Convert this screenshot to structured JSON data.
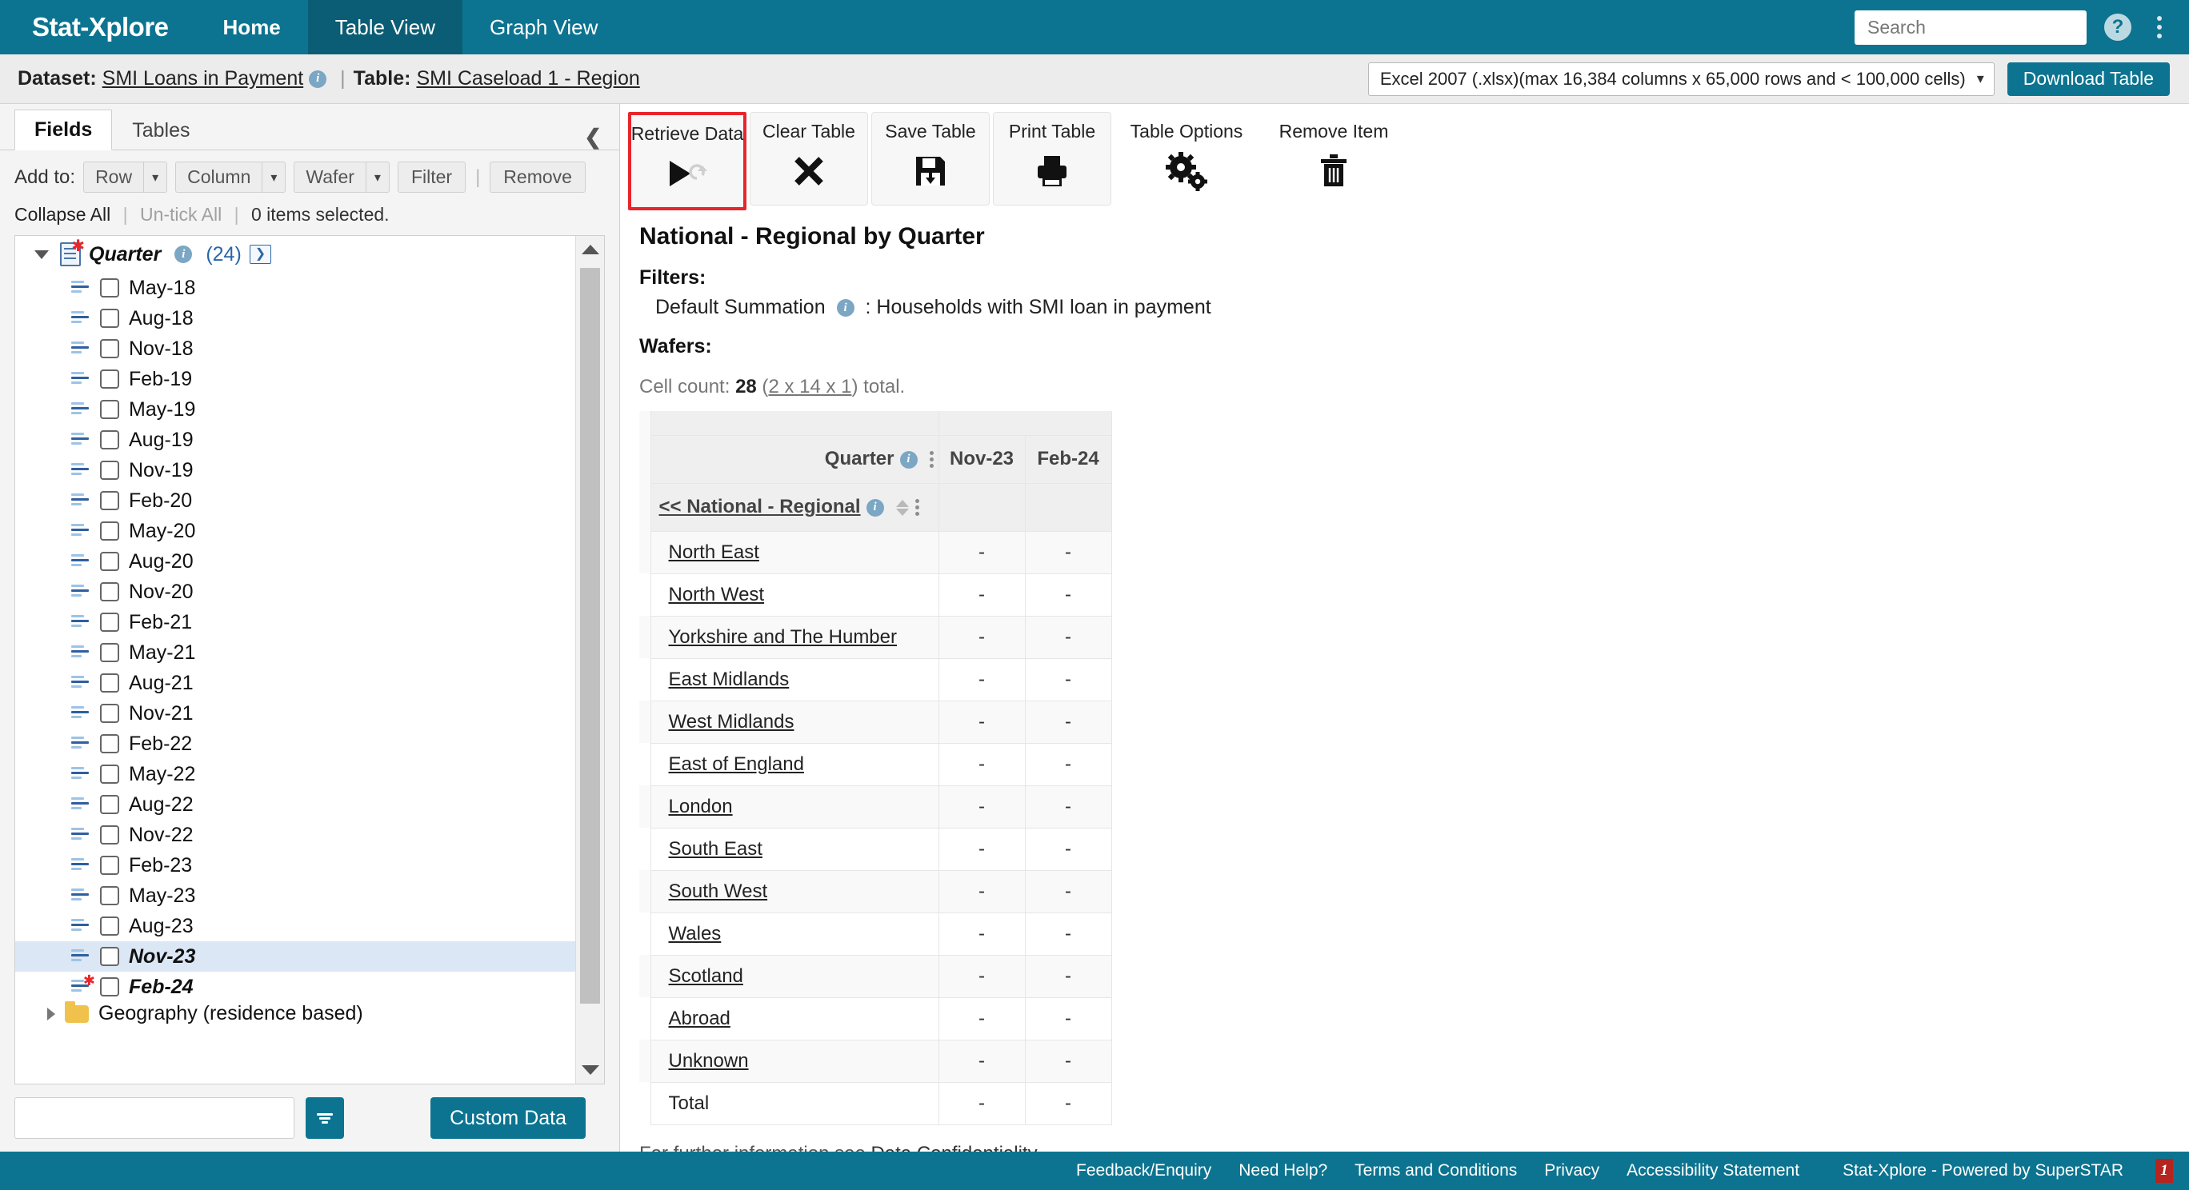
{
  "header": {
    "brand": "Stat-Xplore",
    "tabs": [
      {
        "label": "Home",
        "active": false,
        "bold": true
      },
      {
        "label": "Table View",
        "active": true,
        "bold": false
      },
      {
        "label": "Graph View",
        "active": false,
        "bold": false
      }
    ],
    "search_placeholder": "Search",
    "search_value": "",
    "help_glyph": "?",
    "accent_color": "#0c7490",
    "active_tab_color": "#0a5d74"
  },
  "dataset_bar": {
    "dataset_label": "Dataset:",
    "dataset_name": "SMI Loans in Payment",
    "table_label": "Table:",
    "table_name": "SMI Caseload 1 - Region",
    "format_value": "Excel 2007 (.xlsx)(max 16,384 columns x 65,000 rows and < 100,000 cells)",
    "download_label": "Download Table"
  },
  "left_pane": {
    "tabs": [
      {
        "label": "Fields",
        "active": true
      },
      {
        "label": "Tables",
        "active": false
      }
    ],
    "add_to_label": "Add to:",
    "add_to_buttons": [
      "Row",
      "Column",
      "Wafer"
    ],
    "filter_button": "Filter",
    "remove_button": "Remove",
    "collapse_all": "Collapse All",
    "untick_all": "Un-tick All",
    "selected_text": "0 items selected.",
    "tree": {
      "root": {
        "name": "Quarter",
        "count": "(24)",
        "next": "›"
      },
      "items": [
        {
          "label": "May-18",
          "selected": false,
          "bold": false,
          "new": false
        },
        {
          "label": "Aug-18",
          "selected": false,
          "bold": false,
          "new": false
        },
        {
          "label": "Nov-18",
          "selected": false,
          "bold": false,
          "new": false
        },
        {
          "label": "Feb-19",
          "selected": false,
          "bold": false,
          "new": false
        },
        {
          "label": "May-19",
          "selected": false,
          "bold": false,
          "new": false
        },
        {
          "label": "Aug-19",
          "selected": false,
          "bold": false,
          "new": false
        },
        {
          "label": "Nov-19",
          "selected": false,
          "bold": false,
          "new": false
        },
        {
          "label": "Feb-20",
          "selected": false,
          "bold": false,
          "new": false
        },
        {
          "label": "May-20",
          "selected": false,
          "bold": false,
          "new": false
        },
        {
          "label": "Aug-20",
          "selected": false,
          "bold": false,
          "new": false
        },
        {
          "label": "Nov-20",
          "selected": false,
          "bold": false,
          "new": false
        },
        {
          "label": "Feb-21",
          "selected": false,
          "bold": false,
          "new": false
        },
        {
          "label": "May-21",
          "selected": false,
          "bold": false,
          "new": false
        },
        {
          "label": "Aug-21",
          "selected": false,
          "bold": false,
          "new": false
        },
        {
          "label": "Nov-21",
          "selected": false,
          "bold": false,
          "new": false
        },
        {
          "label": "Feb-22",
          "selected": false,
          "bold": false,
          "new": false
        },
        {
          "label": "May-22",
          "selected": false,
          "bold": false,
          "new": false
        },
        {
          "label": "Aug-22",
          "selected": false,
          "bold": false,
          "new": false
        },
        {
          "label": "Nov-22",
          "selected": false,
          "bold": false,
          "new": false
        },
        {
          "label": "Feb-23",
          "selected": false,
          "bold": false,
          "new": false
        },
        {
          "label": "May-23",
          "selected": false,
          "bold": false,
          "new": false
        },
        {
          "label": "Aug-23",
          "selected": false,
          "bold": false,
          "new": false
        },
        {
          "label": "Nov-23",
          "selected": true,
          "bold": true,
          "new": false
        },
        {
          "label": "Feb-24",
          "selected": false,
          "bold": true,
          "new": true
        }
      ],
      "next_folder": "Geography (residence based)"
    },
    "field_input_value": "",
    "custom_data_label": "Custom Data"
  },
  "toolbar": {
    "buttons": [
      {
        "label": "Retrieve Data",
        "icon": "play-icon",
        "highlighted": true,
        "flat": false
      },
      {
        "label": "Clear Table",
        "icon": "cross-icon",
        "highlighted": false,
        "flat": false
      },
      {
        "label": "Save Table",
        "icon": "floppy-disk-icon",
        "highlighted": false,
        "flat": false
      },
      {
        "label": "Print Table",
        "icon": "printer-icon",
        "highlighted": false,
        "flat": false
      },
      {
        "label": "Table Options",
        "icon": "gears-icon",
        "highlighted": false,
        "flat": true
      },
      {
        "label": "Remove Item",
        "icon": "trash-icon",
        "highlighted": false,
        "flat": true
      }
    ],
    "highlight_color": "#e8252b"
  },
  "table_view": {
    "title": "National - Regional by Quarter",
    "filters_label": "Filters:",
    "filter_line_name": "Default Summation",
    "filter_line_value": ": Households with SMI loan in payment",
    "wafers_label": "Wafers:",
    "cell_count_prefix": "Cell count:",
    "cell_count": "28",
    "cell_count_dims": "2 x 14 x 1",
    "cell_count_suffix": "total.",
    "column_dimension": "Quarter",
    "row_dimension": "<< National - Regional",
    "columns": [
      "Nov-23",
      "Feb-24"
    ],
    "rows": [
      {
        "label": "North East",
        "link": true,
        "values": [
          "-",
          "-"
        ]
      },
      {
        "label": "North West",
        "link": true,
        "values": [
          "-",
          "-"
        ]
      },
      {
        "label": "Yorkshire and The Humber",
        "link": true,
        "values": [
          "-",
          "-"
        ]
      },
      {
        "label": "East Midlands",
        "link": true,
        "values": [
          "-",
          "-"
        ]
      },
      {
        "label": "West Midlands",
        "link": true,
        "values": [
          "-",
          "-"
        ]
      },
      {
        "label": "East of England",
        "link": true,
        "values": [
          "-",
          "-"
        ]
      },
      {
        "label": "London",
        "link": true,
        "values": [
          "-",
          "-"
        ]
      },
      {
        "label": "South East",
        "link": true,
        "values": [
          "-",
          "-"
        ]
      },
      {
        "label": "South West",
        "link": true,
        "values": [
          "-",
          "-"
        ]
      },
      {
        "label": "Wales",
        "link": true,
        "values": [
          "-",
          "-"
        ]
      },
      {
        "label": "Scotland",
        "link": true,
        "values": [
          "-",
          "-"
        ]
      },
      {
        "label": "Abroad",
        "link": true,
        "values": [
          "-",
          "-"
        ]
      },
      {
        "label": "Unknown",
        "link": true,
        "values": [
          "-",
          "-"
        ]
      },
      {
        "label": "Total",
        "link": false,
        "values": [
          "-",
          "-"
        ]
      }
    ],
    "further_info_prefix": "For further information see",
    "further_info_link": "Data Confidentiality"
  },
  "footer": {
    "links": [
      "Feedback/Enquiry",
      "Need Help?",
      "Terms and Conditions",
      "Privacy",
      "Accessibility Statement",
      "Stat-Xplore - Powered by SuperSTAR"
    ],
    "logo_text": "1"
  }
}
